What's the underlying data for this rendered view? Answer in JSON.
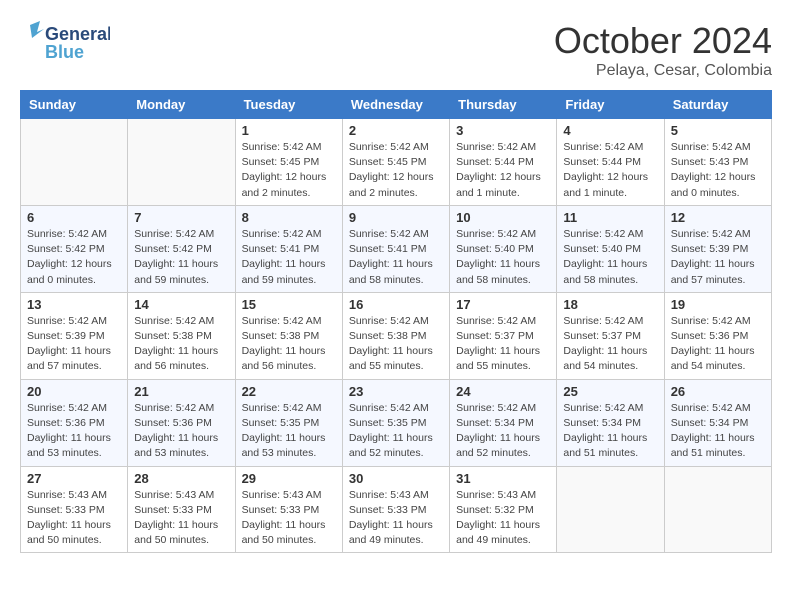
{
  "header": {
    "logo_general": "General",
    "logo_blue": "Blue",
    "month": "October 2024",
    "location": "Pelaya, Cesar, Colombia"
  },
  "days_of_week": [
    "Sunday",
    "Monday",
    "Tuesday",
    "Wednesday",
    "Thursday",
    "Friday",
    "Saturday"
  ],
  "weeks": [
    [
      {
        "day": "",
        "info": ""
      },
      {
        "day": "",
        "info": ""
      },
      {
        "day": "1",
        "info": "Sunrise: 5:42 AM\nSunset: 5:45 PM\nDaylight: 12 hours\nand 2 minutes."
      },
      {
        "day": "2",
        "info": "Sunrise: 5:42 AM\nSunset: 5:45 PM\nDaylight: 12 hours\nand 2 minutes."
      },
      {
        "day": "3",
        "info": "Sunrise: 5:42 AM\nSunset: 5:44 PM\nDaylight: 12 hours\nand 1 minute."
      },
      {
        "day": "4",
        "info": "Sunrise: 5:42 AM\nSunset: 5:44 PM\nDaylight: 12 hours\nand 1 minute."
      },
      {
        "day": "5",
        "info": "Sunrise: 5:42 AM\nSunset: 5:43 PM\nDaylight: 12 hours\nand 0 minutes."
      }
    ],
    [
      {
        "day": "6",
        "info": "Sunrise: 5:42 AM\nSunset: 5:42 PM\nDaylight: 12 hours\nand 0 minutes."
      },
      {
        "day": "7",
        "info": "Sunrise: 5:42 AM\nSunset: 5:42 PM\nDaylight: 11 hours\nand 59 minutes."
      },
      {
        "day": "8",
        "info": "Sunrise: 5:42 AM\nSunset: 5:41 PM\nDaylight: 11 hours\nand 59 minutes."
      },
      {
        "day": "9",
        "info": "Sunrise: 5:42 AM\nSunset: 5:41 PM\nDaylight: 11 hours\nand 58 minutes."
      },
      {
        "day": "10",
        "info": "Sunrise: 5:42 AM\nSunset: 5:40 PM\nDaylight: 11 hours\nand 58 minutes."
      },
      {
        "day": "11",
        "info": "Sunrise: 5:42 AM\nSunset: 5:40 PM\nDaylight: 11 hours\nand 58 minutes."
      },
      {
        "day": "12",
        "info": "Sunrise: 5:42 AM\nSunset: 5:39 PM\nDaylight: 11 hours\nand 57 minutes."
      }
    ],
    [
      {
        "day": "13",
        "info": "Sunrise: 5:42 AM\nSunset: 5:39 PM\nDaylight: 11 hours\nand 57 minutes."
      },
      {
        "day": "14",
        "info": "Sunrise: 5:42 AM\nSunset: 5:38 PM\nDaylight: 11 hours\nand 56 minutes."
      },
      {
        "day": "15",
        "info": "Sunrise: 5:42 AM\nSunset: 5:38 PM\nDaylight: 11 hours\nand 56 minutes."
      },
      {
        "day": "16",
        "info": "Sunrise: 5:42 AM\nSunset: 5:38 PM\nDaylight: 11 hours\nand 55 minutes."
      },
      {
        "day": "17",
        "info": "Sunrise: 5:42 AM\nSunset: 5:37 PM\nDaylight: 11 hours\nand 55 minutes."
      },
      {
        "day": "18",
        "info": "Sunrise: 5:42 AM\nSunset: 5:37 PM\nDaylight: 11 hours\nand 54 minutes."
      },
      {
        "day": "19",
        "info": "Sunrise: 5:42 AM\nSunset: 5:36 PM\nDaylight: 11 hours\nand 54 minutes."
      }
    ],
    [
      {
        "day": "20",
        "info": "Sunrise: 5:42 AM\nSunset: 5:36 PM\nDaylight: 11 hours\nand 53 minutes."
      },
      {
        "day": "21",
        "info": "Sunrise: 5:42 AM\nSunset: 5:36 PM\nDaylight: 11 hours\nand 53 minutes."
      },
      {
        "day": "22",
        "info": "Sunrise: 5:42 AM\nSunset: 5:35 PM\nDaylight: 11 hours\nand 53 minutes."
      },
      {
        "day": "23",
        "info": "Sunrise: 5:42 AM\nSunset: 5:35 PM\nDaylight: 11 hours\nand 52 minutes."
      },
      {
        "day": "24",
        "info": "Sunrise: 5:42 AM\nSunset: 5:34 PM\nDaylight: 11 hours\nand 52 minutes."
      },
      {
        "day": "25",
        "info": "Sunrise: 5:42 AM\nSunset: 5:34 PM\nDaylight: 11 hours\nand 51 minutes."
      },
      {
        "day": "26",
        "info": "Sunrise: 5:42 AM\nSunset: 5:34 PM\nDaylight: 11 hours\nand 51 minutes."
      }
    ],
    [
      {
        "day": "27",
        "info": "Sunrise: 5:43 AM\nSunset: 5:33 PM\nDaylight: 11 hours\nand 50 minutes."
      },
      {
        "day": "28",
        "info": "Sunrise: 5:43 AM\nSunset: 5:33 PM\nDaylight: 11 hours\nand 50 minutes."
      },
      {
        "day": "29",
        "info": "Sunrise: 5:43 AM\nSunset: 5:33 PM\nDaylight: 11 hours\nand 50 minutes."
      },
      {
        "day": "30",
        "info": "Sunrise: 5:43 AM\nSunset: 5:33 PM\nDaylight: 11 hours\nand 49 minutes."
      },
      {
        "day": "31",
        "info": "Sunrise: 5:43 AM\nSunset: 5:32 PM\nDaylight: 11 hours\nand 49 minutes."
      },
      {
        "day": "",
        "info": ""
      },
      {
        "day": "",
        "info": ""
      }
    ]
  ]
}
